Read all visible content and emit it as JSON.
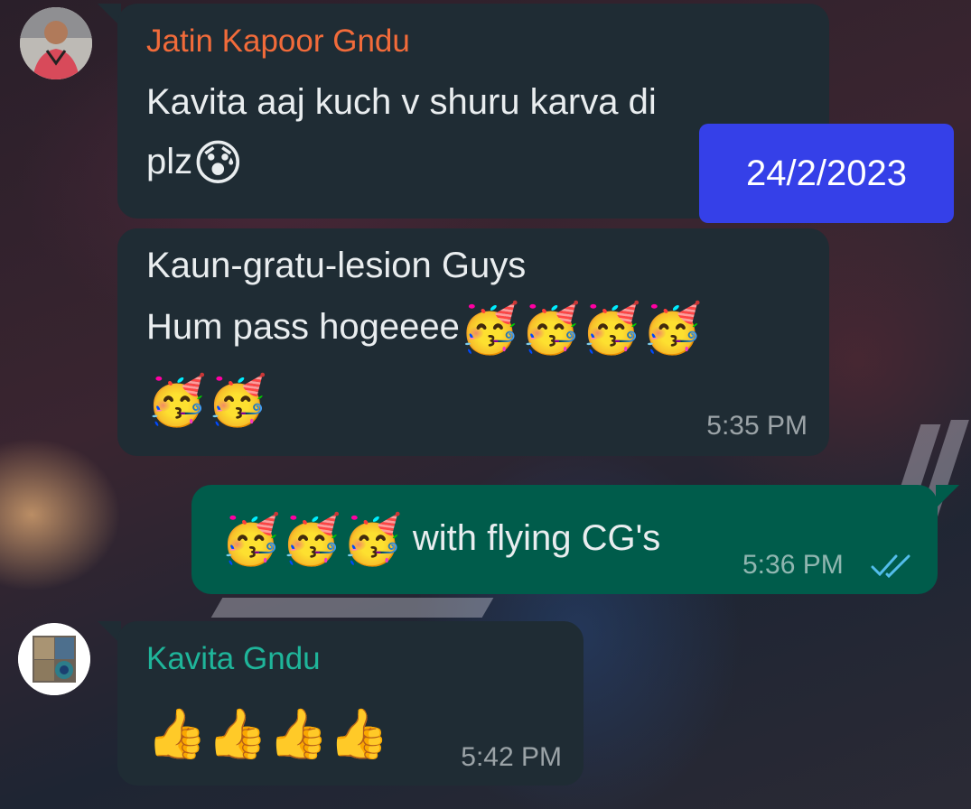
{
  "date_badge": "24/2/2023",
  "messages": [
    {
      "sender": "Jatin Kapoor Gndu",
      "sender_color": "#f26b3a",
      "line1": "Kavita aaj kuch v shuru karva di",
      "line2": "plz",
      "emoji": "😰"
    },
    {
      "line1": "Kaun-gratu-lesion Guys",
      "line2": "Hum pass hogeeee",
      "emoji_row1": "🥳🥳🥳🥳",
      "emoji_row2": "🥳🥳",
      "time": "5:35 PM"
    },
    {
      "direction": "outgoing",
      "emojis": "🥳🥳🥳",
      "text": " with flying CG's",
      "time": "5:36 PM",
      "status": "read-double-check",
      "status_color": "#53bdeb"
    },
    {
      "sender": "Kavita Gndu",
      "sender_color": "#1fb59a",
      "emojis": "👍👍👍👍",
      "time": "5:42 PM"
    }
  ],
  "colors": {
    "incoming_bubble": "#1f2c34",
    "outgoing_bubble": "#005c4b",
    "date_chip": "#3540e8"
  }
}
